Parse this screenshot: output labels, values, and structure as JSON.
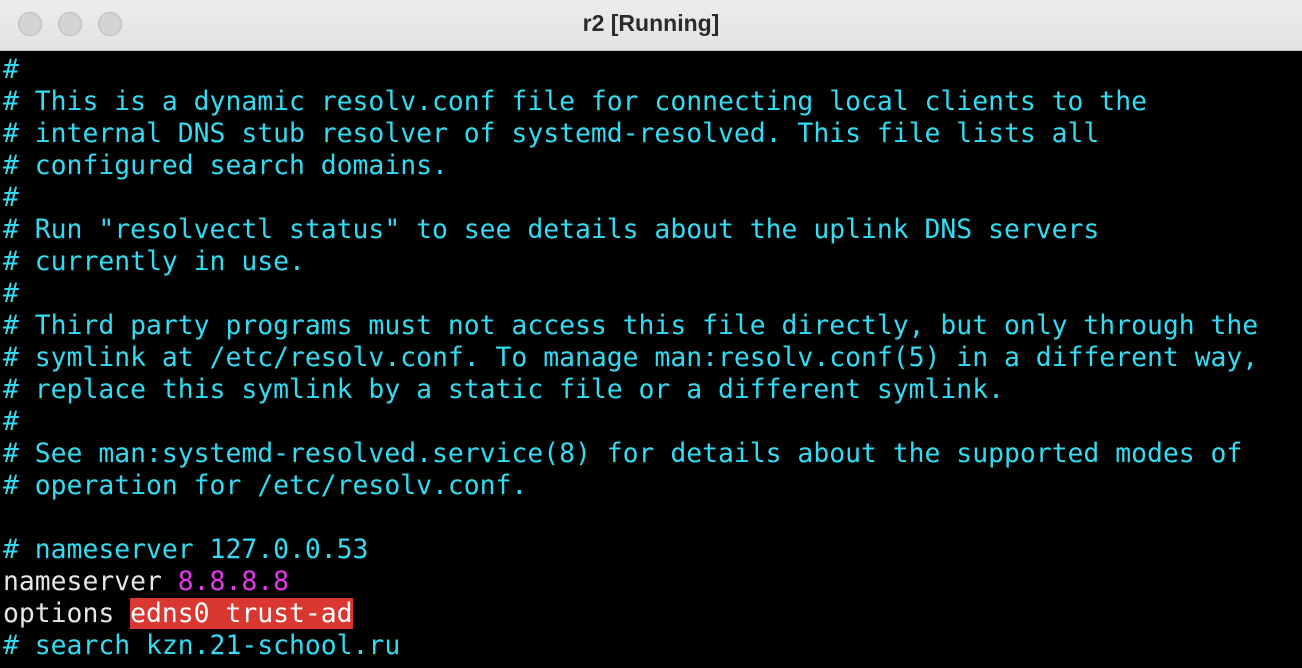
{
  "window": {
    "title": "r2 [Running]"
  },
  "terminal": {
    "comment_lines": [
      "#",
      "# This is a dynamic resolv.conf file for connecting local clients to the",
      "# internal DNS stub resolver of systemd-resolved. This file lists all",
      "# configured search domains.",
      "#",
      "# Run \"resolvectl status\" to see details about the uplink DNS servers",
      "# currently in use.",
      "#",
      "# Third party programs must not access this file directly, but only through the",
      "# symlink at /etc/resolv.conf. To manage man:resolv.conf(5) in a different way,",
      "# replace this symlink by a static file or a different symlink.",
      "#",
      "# See man:systemd-resolved.service(8) for details about the supported modes of",
      "# operation for /etc/resolv.conf."
    ],
    "commented_nameserver": "# nameserver 127.0.0.53",
    "nameserver_keyword": "nameserver",
    "nameserver_value": "8.8.8.8",
    "options_keyword": "options",
    "options_value": "edns0 trust-ad",
    "search_comment": "# search kzn.21-school.ru"
  },
  "colors": {
    "comment": "#33dcf2",
    "keyword": "#e6e6e6",
    "ip": "#e637ea",
    "highlight": "#d9372f"
  }
}
